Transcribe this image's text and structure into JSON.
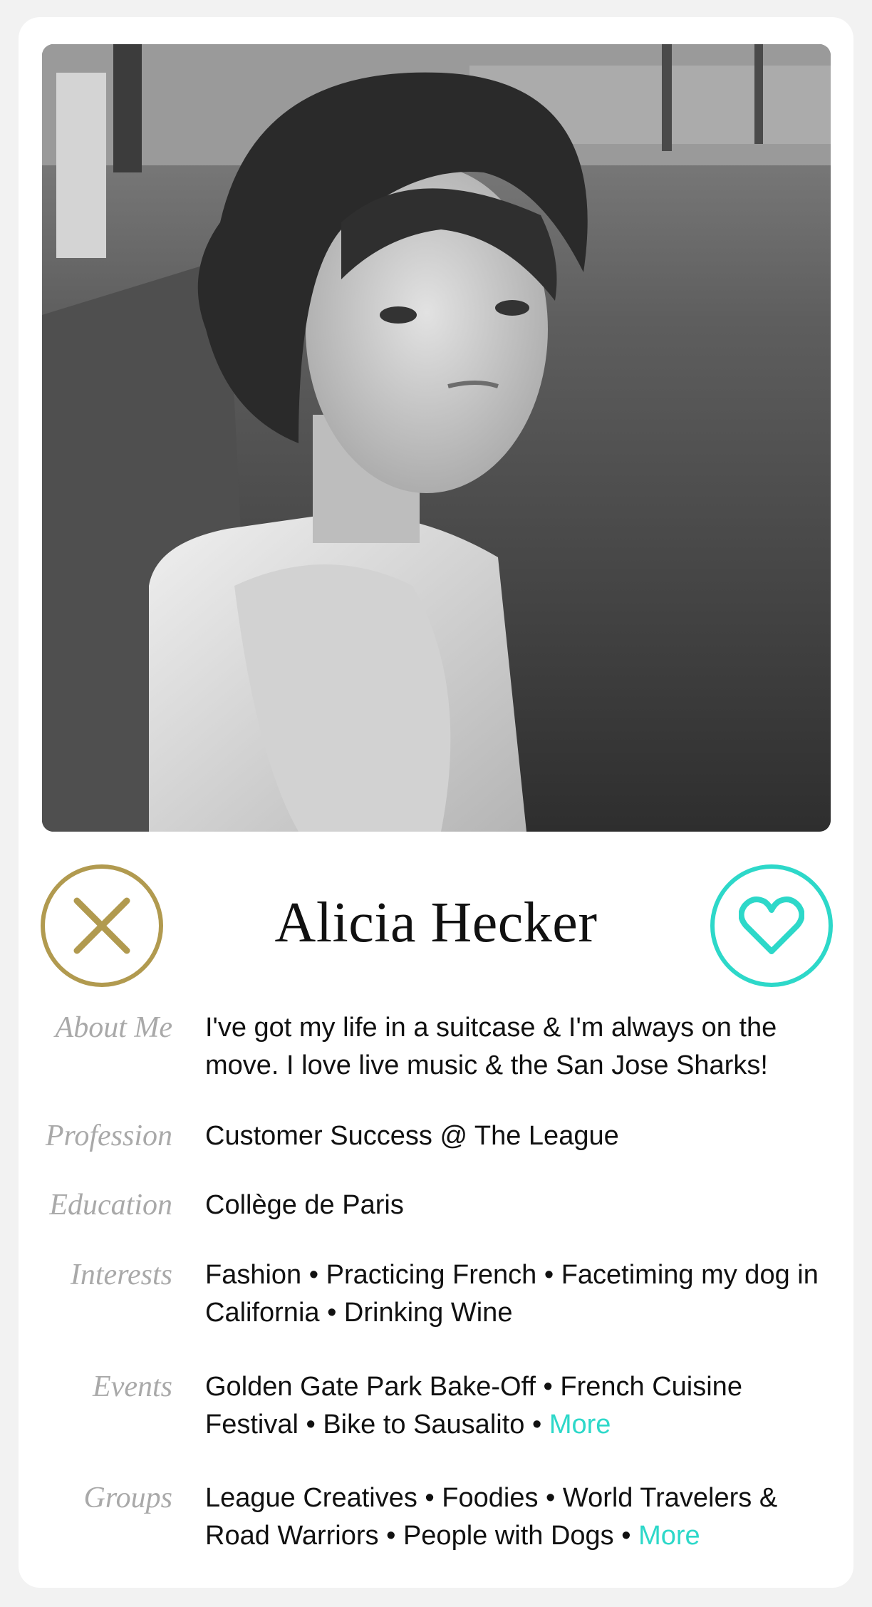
{
  "profile": {
    "name": "Alicia Hecker",
    "photo_alt": "Black and white portrait photo"
  },
  "actions": {
    "pass_icon": "close-icon",
    "like_icon": "heart-icon",
    "pass_color": "#b19a4f",
    "like_color": "#2dd8c9"
  },
  "fields": {
    "about": {
      "label": "About Me",
      "value": "I've got my life in a suitcase & I'm always on the move. I love live music & the San Jose Sharks!"
    },
    "profession": {
      "label": "Profession",
      "value": "Customer Success @ The League"
    },
    "education": {
      "label": "Education",
      "value": "Collège de Paris"
    },
    "interests": {
      "label": "Interests",
      "value": "Fashion • Practicing French • Facetiming my dog in California • Drinking Wine"
    },
    "events": {
      "label": "Events",
      "value": "Golden Gate Park Bake-Off • French Cuisine Festival • Bike to Sausalito •",
      "more": "More"
    },
    "groups": {
      "label": "Groups",
      "value": "League Creatives • Foodies • World Travelers & Road Warriors • People with Dogs •",
      "more": "More"
    }
  }
}
